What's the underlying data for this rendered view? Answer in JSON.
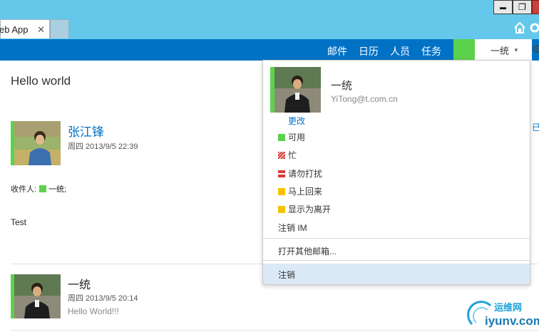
{
  "browser": {
    "tab_title": "eb App",
    "tab_close": "✕",
    "win_min": "▬",
    "win_max": "❐",
    "icons": [
      "home-icon",
      "gear-icon"
    ]
  },
  "header": {
    "nav": [
      "邮件",
      "日历",
      "人员",
      "任务"
    ],
    "user_name": "一统",
    "user_caret": "▼",
    "settings_glyph": "⚙",
    "presence_color": "#5cd24c",
    "bar_color": "#0072c6"
  },
  "main": {
    "title": "Hello world",
    "message1": {
      "sender": "张江锋",
      "time": "周四 2013/9/5 22:39",
      "to_label": "收件人:",
      "to_name": "一统;",
      "body": "Test"
    },
    "message2": {
      "sender": "一统",
      "time": "周四 2013/9/5 20:14",
      "preview": "Hello World!!!"
    },
    "edge_text": "已"
  },
  "dropdown": {
    "name": "一统",
    "email": "YiTong@t.com.cn",
    "change_link": "更改",
    "statuses": [
      {
        "label": "可用",
        "color": "#5cd24c"
      },
      {
        "label": "忙",
        "color": "#d63b3b"
      },
      {
        "label": "请勿打扰",
        "color": "#d63b3b"
      },
      {
        "label": "马上回来",
        "color": "#f5c400"
      },
      {
        "label": "显示为离开",
        "color": "#f5c400"
      }
    ],
    "signout_im": "注销 IM",
    "open_other": "打开其他邮箱...",
    "logout": "注销"
  },
  "watermark": {
    "title": "运维网",
    "url": "iyunv.com"
  }
}
